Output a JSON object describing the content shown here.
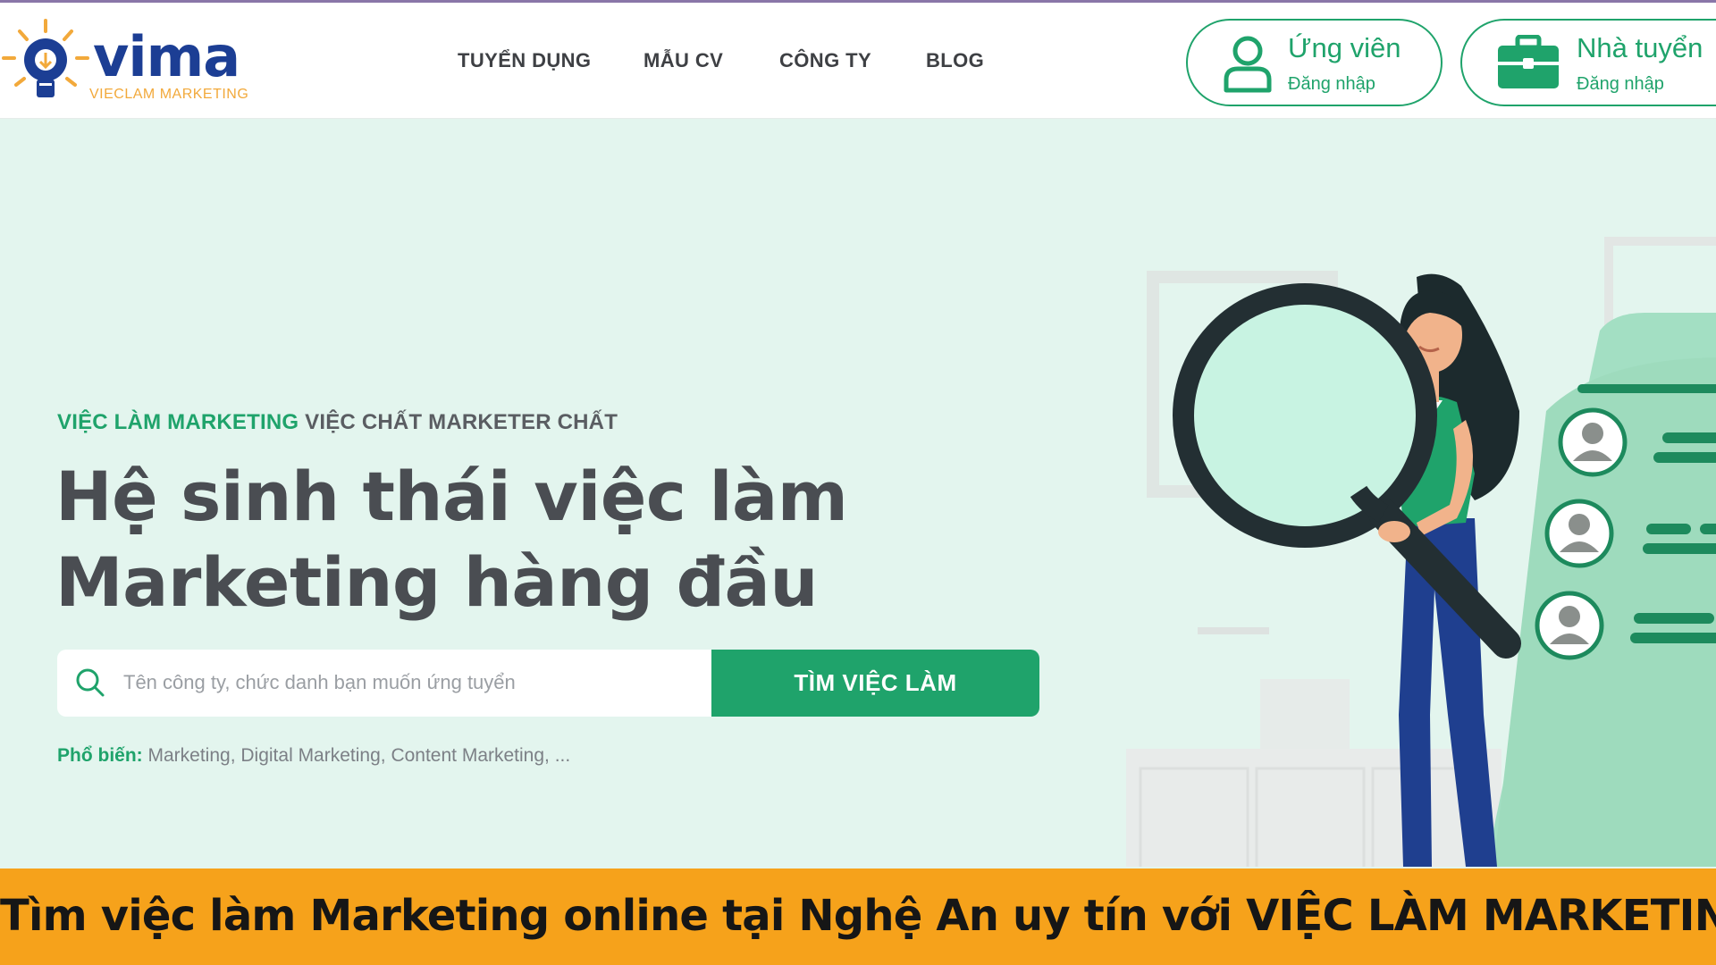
{
  "brand": {
    "name": "vima",
    "tagline": "VIECLAM MARKETING",
    "primary_color": "#1fa36b",
    "logo_blue": "#1c3e94",
    "logo_orange": "#f2a93b"
  },
  "nav": {
    "items": [
      "TUYỂN DỤNG",
      "MẪU CV",
      "CÔNG TY",
      "BLOG"
    ]
  },
  "auth": {
    "candidate": {
      "title": "Ứng viên",
      "subtitle": "Đăng nhập",
      "icon": "user-icon"
    },
    "employer": {
      "title": "Nhà tuyển",
      "subtitle": "Đăng nhập",
      "icon": "briefcase-icon"
    }
  },
  "hero": {
    "tag_accent": "VIỆC LÀM MARKETING",
    "tag_rest": " VIỆC CHẤT MARKETER CHẤT",
    "title_lines": [
      "Hệ sinh thái việc làm",
      "Marketing hàng đầu"
    ],
    "search": {
      "placeholder": "Tên công ty, chức danh bạn muốn ứng tuyển",
      "value": "",
      "button": "TÌM VIỆC LÀM",
      "icon": "search-icon"
    },
    "popular": {
      "label": "Phổ biến:",
      "items": " Marketing, Digital Marketing, Content Marketing, ..."
    }
  },
  "banner": {
    "text": "Tìm việc làm Marketing online tại Nghệ An uy tín với VIỆC LÀM MARKETING",
    "color": "#f6a21b"
  }
}
